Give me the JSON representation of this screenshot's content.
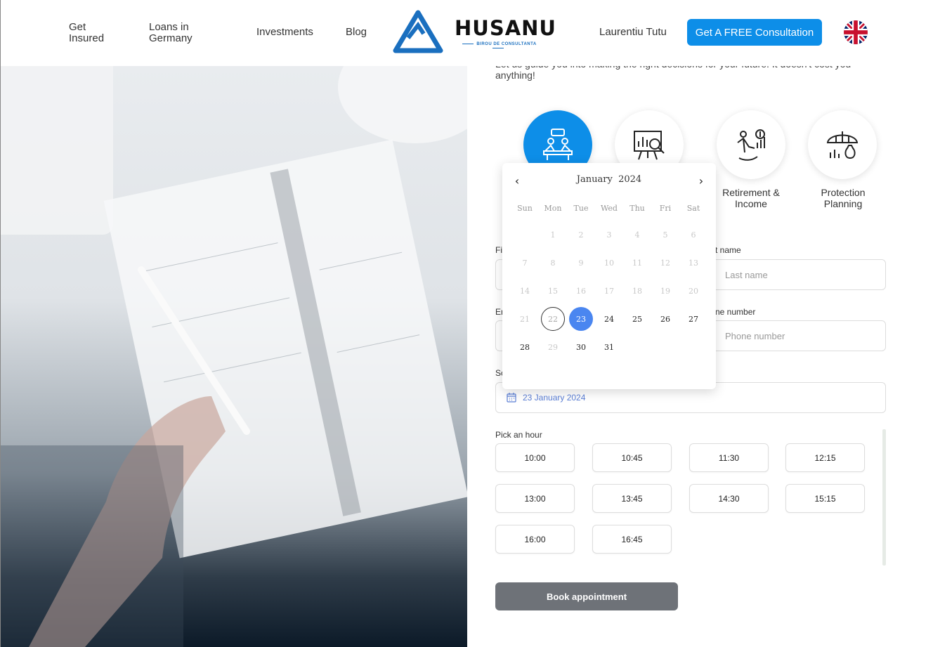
{
  "header": {
    "nav": [
      "Get Insured",
      "Loans in Germany",
      "Investments",
      "Blog"
    ],
    "brand": "HUSANU",
    "brand_sub": "BIROU DE CONSULTANTA",
    "user": "Laurentiu Tutu",
    "cta": "Get A FREE Consultation"
  },
  "intro": "Let us guide you into making the right decisions for your future. It doesn't cost you anything!",
  "services": [
    {
      "icon": "meeting-icon",
      "label": ""
    },
    {
      "icon": "presentation-analysis-icon",
      "label": ""
    },
    {
      "icon": "retirement-icon",
      "label": "Retirement & Income"
    },
    {
      "icon": "protection-umbrella-icon",
      "label": "Protection Planning"
    }
  ],
  "form": {
    "first_name_label": "Fi",
    "last_name_label": "t name",
    "last_name_placeholder": "Last name",
    "email_label": "Er",
    "phone_label": "ne number",
    "phone_placeholder": "Phone number",
    "schedule_label": "Sc",
    "date_value": "23 January 2024",
    "hour_label": "Pick an hour",
    "hours": [
      "10:00",
      "10:45",
      "11:30",
      "12:15",
      "13:00",
      "13:45",
      "14:30",
      "15:15",
      "16:00",
      "16:45"
    ],
    "submit": "Book appointment"
  },
  "calendar": {
    "month": "January",
    "year": "2024",
    "weekdays": [
      "Sun",
      "Mon",
      "Tue",
      "Wed",
      "Thu",
      "Fri",
      "Sat"
    ],
    "weeks": [
      [
        "",
        "1",
        "2",
        "3",
        "4",
        "5",
        "6"
      ],
      [
        "7",
        "8",
        "9",
        "10",
        "11",
        "12",
        "13"
      ],
      [
        "14",
        "15",
        "16",
        "17",
        "18",
        "19",
        "20"
      ],
      [
        "21",
        "22",
        "23",
        "24",
        "25",
        "26",
        "27"
      ],
      [
        "28",
        "29",
        "30",
        "31",
        "",
        "",
        ""
      ]
    ],
    "disabled": [
      "1",
      "2",
      "3",
      "4",
      "5",
      "6",
      "7",
      "8",
      "9",
      "10",
      "11",
      "12",
      "13",
      "14",
      "15",
      "16",
      "17",
      "18",
      "19",
      "20",
      "21",
      "22",
      "29"
    ],
    "today": "22",
    "selected": "23",
    "selected_color": "#4a86f0"
  },
  "colors": {
    "accent": "#0d8ee8",
    "button_disabled": "#6e7278"
  }
}
